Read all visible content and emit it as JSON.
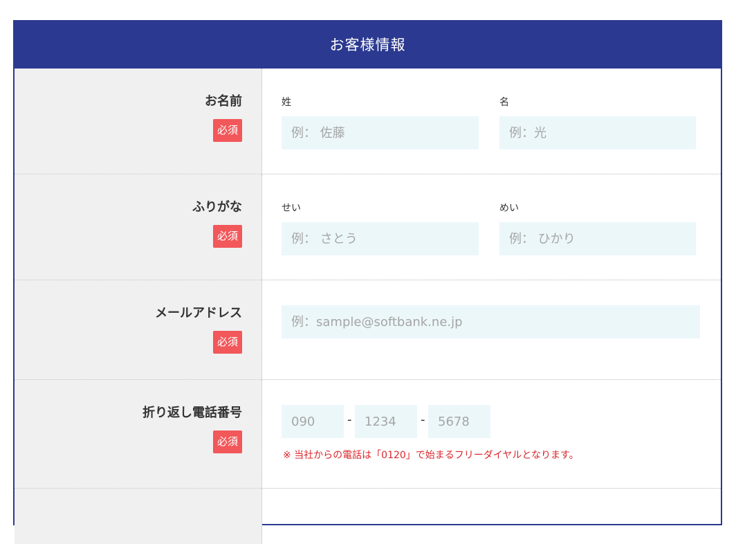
{
  "header": {
    "title": "お客様情報"
  },
  "required_label": "必須",
  "rows": {
    "name": {
      "label": "お名前",
      "last": {
        "label": "姓",
        "placeholder": "例： 佐藤"
      },
      "first": {
        "label": "名",
        "placeholder": "例：光"
      }
    },
    "kana": {
      "label": "ふりがな",
      "last": {
        "label": "せい",
        "placeholder": "例： さとう"
      },
      "first": {
        "label": "めい",
        "placeholder": "例： ひかり"
      }
    },
    "email": {
      "label": "メールアドレス",
      "placeholder": "例：sample@softbank.ne.jp"
    },
    "phone": {
      "label": "折り返し電話番号",
      "part1_placeholder": "090",
      "part2_placeholder": "1234",
      "part3_placeholder": "5678",
      "separator": "-",
      "note": "※ 当社からの電話は「0120」で始まるフリーダイヤルとなります。"
    }
  },
  "colors": {
    "header_bg": "#2b3990",
    "badge_bg": "#f2575a",
    "input_bg": "#ecf7fa",
    "note_text": "#d9272d"
  }
}
